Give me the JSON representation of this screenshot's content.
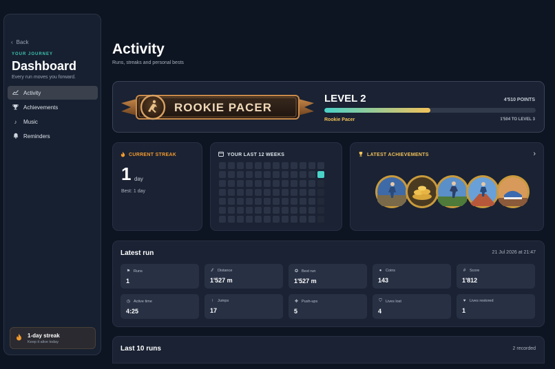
{
  "sidebar": {
    "back_label": "Back",
    "eyebrow": "YOUR JOURNEY",
    "title": "Dashboard",
    "subtitle": "Every run moves you forward.",
    "items": [
      {
        "label": "Activity",
        "icon": "chart-icon",
        "active": true
      },
      {
        "label": "Achievements",
        "icon": "trophy-icon",
        "active": false
      },
      {
        "label": "Music",
        "icon": "music-note-icon",
        "active": false
      },
      {
        "label": "Reminders",
        "icon": "bell-icon",
        "active": false
      }
    ],
    "streak_box": {
      "title": "1-day streak",
      "subtitle": "Keep it alive today",
      "icon": "flame-icon"
    }
  },
  "header": {
    "title": "Activity",
    "subtitle": "Runs, streaks and personal bests"
  },
  "level": {
    "badge_text": "ROOKIE PACER",
    "label": "LEVEL 2",
    "points": "4'510 POINTS",
    "progress": 0.5,
    "rank_name": "Rookie Pacer",
    "to_next": "1'504 TO LEVEL 3",
    "colors": {
      "bar_start": "#4ad2c8",
      "bar_end": "#f2c25a"
    }
  },
  "streak": {
    "header": "CURRENT STREAK",
    "value": "1",
    "unit": "day",
    "best": "Best: 1 day"
  },
  "weeks": {
    "header": "YOUR LAST 12 WEEKS",
    "columns": 12,
    "rows": 7,
    "active_cells": [
      [
        11,
        1
      ]
    ],
    "future_start": {
      "col": 11,
      "row": 2
    }
  },
  "achievements": {
    "header": "LATEST ACHIEVEMENTS",
    "medals": [
      "runner-medal",
      "coins-medal",
      "sprinter-medal",
      "track-medal",
      "shoe-medal"
    ]
  },
  "latest_run": {
    "title": "Latest run",
    "date": "21 Jul 2026 at 21:47",
    "stats": [
      {
        "label": "Runs",
        "value": "1",
        "icon": "flag-icon"
      },
      {
        "label": "Distance",
        "value": "1'527 m",
        "icon": "road-icon"
      },
      {
        "label": "Best run",
        "value": "1'527 m",
        "icon": "medal-icon"
      },
      {
        "label": "Coins",
        "value": "143",
        "icon": "coin-icon"
      },
      {
        "label": "Score",
        "value": "1'812",
        "icon": "hash-icon"
      },
      {
        "label": "Active time",
        "value": "4:25",
        "icon": "clock-icon"
      },
      {
        "label": "Jumps",
        "value": "17",
        "icon": "arrow-up-icon"
      },
      {
        "label": "Push-ups",
        "value": "5",
        "icon": "pushup-icon"
      },
      {
        "label": "Lives lost",
        "value": "4",
        "icon": "shield-icon"
      },
      {
        "label": "Lives restored",
        "value": "1",
        "icon": "heart-icon"
      }
    ]
  },
  "last_runs": {
    "title": "Last 10 runs",
    "count": "2 recorded"
  }
}
